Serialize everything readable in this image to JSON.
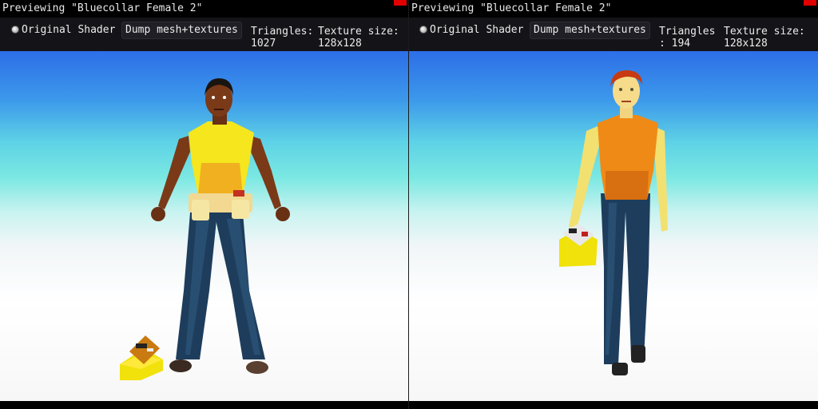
{
  "panels": [
    {
      "title": "Previewing \"Bluecollar Female 2\"",
      "shader_button": "Original Shader",
      "dump_button": "Dump mesh+textures",
      "triangles_label": "Triangles:",
      "triangles_value": "1027",
      "texture_label": "Texture size:",
      "texture_value": "128x128"
    },
    {
      "title": "Previewing \"Bluecollar Female 2\"",
      "shader_button": "Original Shader",
      "dump_button": "Dump mesh+textures",
      "triangles_label": "Triangles",
      "triangles_value": ": 194",
      "texture_label": "Texture size:",
      "texture_value": "128x128"
    }
  ],
  "colors": {
    "close_button": "#e00000",
    "sky_top": "#2d6ee8",
    "sky_cyan": "#7ae8e2",
    "ground": "#ffffff"
  }
}
